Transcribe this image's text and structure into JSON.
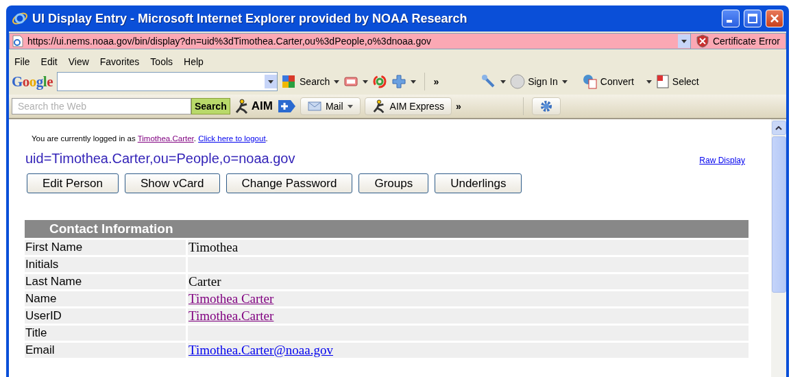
{
  "window": {
    "title": "UI Display Entry - Microsoft Internet Explorer provided by NOAA Research"
  },
  "address_bar": {
    "url": "https://ui.nems.noaa.gov/bin/display?dn=uid%3dTimothea.Carter,ou%3dPeople,o%3dnoaa.gov",
    "security": "Certificate Error"
  },
  "menu": [
    "File",
    "Edit",
    "View",
    "Favorites",
    "Tools",
    "Help"
  ],
  "google_toolbar": {
    "logo": "Google",
    "search_button": "Search",
    "more": "»",
    "sign_in": "Sign In",
    "convert": "Convert",
    "select": "Select"
  },
  "aim_toolbar": {
    "placeholder": "Search the Web",
    "search_button": "Search",
    "logo": "AIM",
    "mail": "Mail",
    "aim_express": "AIM Express",
    "more": "»"
  },
  "page": {
    "login_prefix": "You are currently logged in as ",
    "user_link": "Timothea.Carter",
    "separator": ". ",
    "logout_link": "Click here to logout",
    "end": ".",
    "dn": "uid=Timothea.Carter,ou=People,o=noaa.gov",
    "raw_display": "Raw Display",
    "buttons": [
      "Edit Person",
      "Show vCard",
      "Change Password",
      "Groups",
      "Underlings"
    ],
    "section": {
      "title": "Contact Information",
      "rows": [
        {
          "label": "First Name",
          "value": "Timothea",
          "kind": "text"
        },
        {
          "label": "Initials"
        },
        {
          "label": "Last Name",
          "value": "Carter",
          "kind": "text"
        },
        {
          "label": "Name",
          "value": "Timothea Carter",
          "kind": "visited_link"
        },
        {
          "label": "UserID",
          "value": "Timothea.Carter",
          "kind": "visited_link"
        },
        {
          "label": "Title"
        },
        {
          "label": "Email",
          "value": "Timothea.Carter@noaa.gov",
          "kind": "link"
        }
      ]
    }
  }
}
